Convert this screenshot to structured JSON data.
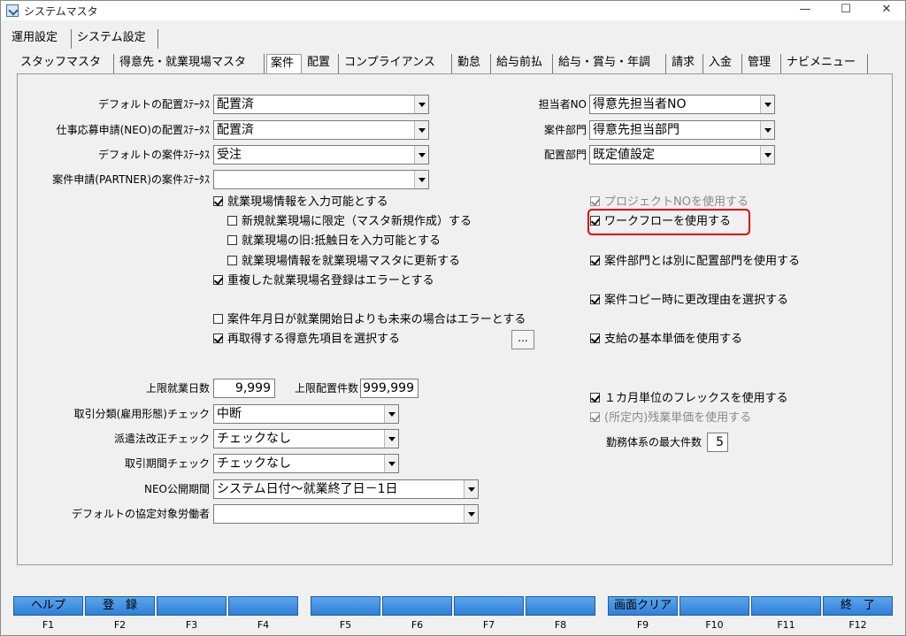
{
  "window": {
    "title": "システムマスタ",
    "min": "—",
    "max": "☐",
    "close": "✕"
  },
  "tabs_top": [
    "運用設定",
    "システム設定"
  ],
  "tabs_sub": [
    "スタッフマスタ",
    "得意先・就業現場マスタ",
    "案件",
    "配置",
    "コンプライアンス",
    "勤怠",
    "給与前払",
    "給与・賞与・年調",
    "請求",
    "入金",
    "管理",
    "ナビメニュー"
  ],
  "active_sub_tab": "案件",
  "left_selects": [
    {
      "label": "デフォルトの配置ｽﾃｰﾀｽ",
      "value": "配置済"
    },
    {
      "label": "仕事応募申請(NEO)の配置ｽﾃｰﾀｽ",
      "value": "配置済"
    },
    {
      "label": "デフォルトの案件ｽﾃｰﾀｽ",
      "value": "受注"
    },
    {
      "label": "案件申請(PARTNER)の案件ｽﾃｰﾀｽ",
      "value": ""
    }
  ],
  "right_selects": [
    {
      "label": "担当者NO",
      "value": "得意先担当者NO"
    },
    {
      "label": "案件部門",
      "value": "得意先担当部門"
    },
    {
      "label": "配置部門",
      "value": "既定値設定"
    }
  ],
  "left_checks": [
    {
      "label": "就業現場情報を入力可能とする",
      "checked": true
    },
    {
      "label": "新規就業現場に限定（マスタ新規作成）する",
      "checked": false
    },
    {
      "label": "就業現場の旧:抵触日を入力可能とする",
      "checked": false
    },
    {
      "label": "就業現場情報を就業現場マスタに更新する",
      "checked": false
    },
    {
      "label": "重複した就業現場名登録はエラーとする",
      "checked": true
    },
    {
      "label": "案件年月日が就業開始日よりも未来の場合はエラーとする",
      "checked": false
    },
    {
      "label": "再取得する得意先項目を選択する",
      "checked": true
    }
  ],
  "dots_button": "...",
  "right_checks": [
    {
      "label": "プロジェクトNOを使用する",
      "checked": true
    },
    {
      "label": "ワークフローを使用する",
      "checked": true
    },
    {
      "label": "案件部門とは別に配置部門を使用する",
      "checked": true
    },
    {
      "label": "案件コピー時に更改理由を選択する",
      "checked": true
    },
    {
      "label": "支給の基本単価を使用する",
      "checked": true
    },
    {
      "label": "１カ月単位のフレックスを使用する",
      "checked": true
    },
    {
      "label": "(所定内)残業単価を使用する",
      "checked": true
    }
  ],
  "limits": {
    "days_label": "上限就業日数",
    "days_value": "9,999",
    "count_label": "上限配置件数",
    "count_value": "999,999"
  },
  "lower_selects": [
    {
      "label": "取引分類(雇用形態)チェック",
      "value": "中断"
    },
    {
      "label": "派遣法改正チェック",
      "value": "チェックなし"
    },
    {
      "label": "取引期間チェック",
      "value": "チェックなし"
    },
    {
      "label": "NEO公開期間",
      "value": "システム日付～就業終了日－1日"
    },
    {
      "label": "デフォルトの協定対象労働者",
      "value": ""
    }
  ],
  "max_shifts": {
    "label": "勤務体系の最大件数",
    "value": "5"
  },
  "fkeys": [
    {
      "label": "ヘルプ",
      "key": "F1"
    },
    {
      "label": "登　録",
      "key": "F2"
    },
    {
      "label": "",
      "key": "F3"
    },
    {
      "label": "",
      "key": "F4"
    },
    {
      "label": "",
      "key": "F5"
    },
    {
      "label": "",
      "key": "F6"
    },
    {
      "label": "",
      "key": "F7"
    },
    {
      "label": "",
      "key": "F8"
    },
    {
      "label": "画面クリア",
      "key": "F9"
    },
    {
      "label": "",
      "key": "F10"
    },
    {
      "label": "",
      "key": "F11"
    },
    {
      "label": "終　了",
      "key": "F12"
    }
  ]
}
